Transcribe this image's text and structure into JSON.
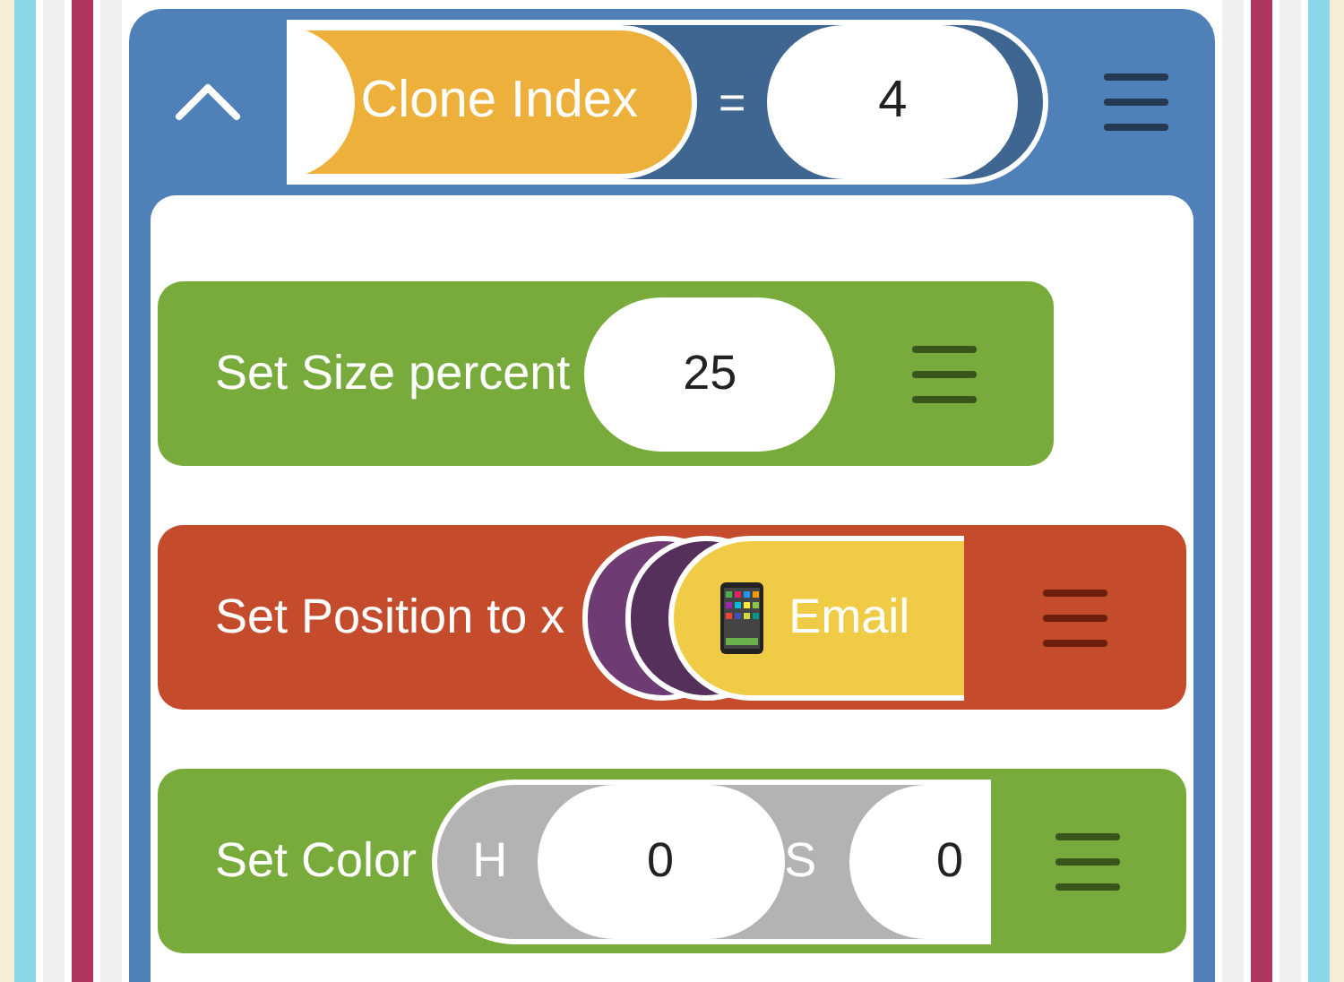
{
  "header": {
    "expanded": true,
    "condition": {
      "variable": "Clone Index",
      "operator": "=",
      "value": "4"
    }
  },
  "blocks": [
    {
      "kind": "size",
      "label": "Set Size percent",
      "color": "#78ab3c",
      "value": "25"
    },
    {
      "kind": "position",
      "label": "Set Position to x",
      "color": "#c44b2c",
      "reporter": "Email"
    },
    {
      "kind": "color",
      "label": "Set Color",
      "color": "#78ab3c",
      "fields": [
        {
          "label": "H",
          "value": "0"
        },
        {
          "label": "S",
          "value": "0"
        }
      ]
    }
  ]
}
